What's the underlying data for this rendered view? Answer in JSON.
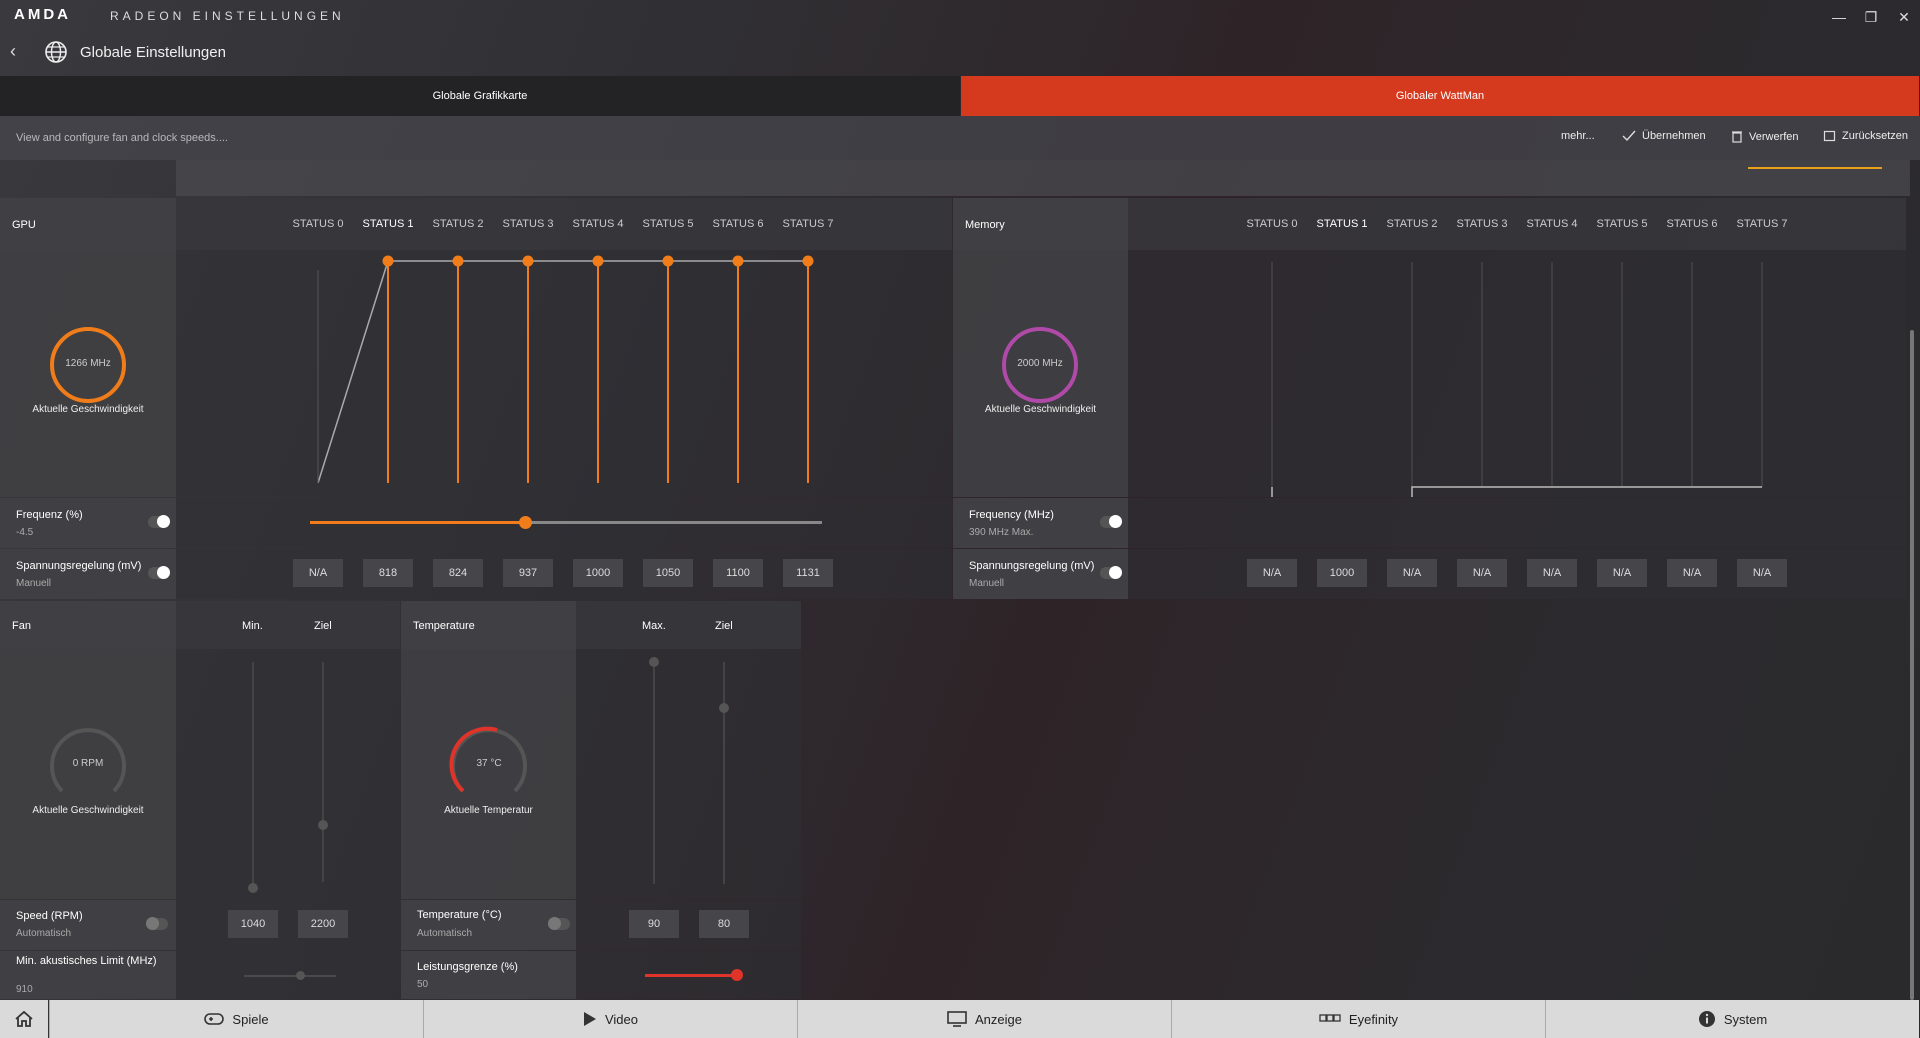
{
  "app": {
    "brand": "AMDA",
    "brand_sub": "RADEON EINSTELLUNGEN"
  },
  "header": {
    "title": "Globale Einstellungen"
  },
  "tabs": [
    {
      "label": "Globale Grafikkarte"
    },
    {
      "label": "Globaler WattMan"
    }
  ],
  "toolbar": {
    "description": "View and configure fan and clock speeds....",
    "more": "mehr...",
    "apply": "Übernehmen",
    "discard": "Verwerfen",
    "reset": "Zurücksetzen"
  },
  "gpu": {
    "label": "GPU",
    "speed": "1266 MHz",
    "speed_label": "Aktuelle Geschwindigkeit",
    "states": [
      "STATUS 0",
      "STATUS 1",
      "STATUS 2",
      "STATUS 3",
      "STATUS 4",
      "STATUS 5",
      "STATUS 6",
      "STATUS 7"
    ],
    "freq_label": "Frequenz (%)",
    "freq_value": "-4.5",
    "freq_slider": 0.42,
    "volt_label": "Spannungsregelung (mV)",
    "volt_mode": "Manuell",
    "volt_values": [
      "N/A",
      "818",
      "824",
      "937",
      "1000",
      "1050",
      "1100",
      "1131"
    ]
  },
  "memory": {
    "label": "Memory",
    "speed": "2000 MHz",
    "speed_label": "Aktuelle Geschwindigkeit",
    "states": [
      "STATUS 0",
      "STATUS 1",
      "STATUS 2",
      "STATUS 3",
      "STATUS 4",
      "STATUS 5",
      "STATUS 6",
      "STATUS 7"
    ],
    "freq_label": "Frequency (MHz)",
    "freq_value": "390 MHz Max.",
    "volt_label": "Spannungsregelung (mV)",
    "volt_mode": "Manuell",
    "volt_values": [
      "N/A",
      "1000",
      "N/A",
      "N/A",
      "N/A",
      "N/A",
      "N/A",
      "N/A"
    ]
  },
  "fan": {
    "label": "Fan",
    "col_min": "Min.",
    "col_target": "Ziel",
    "speed": "0 RPM",
    "speed_label": "Aktuelle Geschwindigkeit",
    "speed_row_label": "Speed (RPM)",
    "speed_row_mode": "Automatisch",
    "speed_min": "1040",
    "speed_target": "2200",
    "acoustic_label": "Min. akustisches Limit (MHz)",
    "acoustic_value": "910"
  },
  "temperature": {
    "label": "Temperature",
    "col_max": "Max.",
    "col_target": "Ziel",
    "current": "37 °C",
    "current_label": "Aktuelle Temperatur",
    "row_label": "Temperature (°C)",
    "row_mode": "Automatisch",
    "max": "90",
    "target": "80",
    "power_label": "Leistungsgrenze (%)",
    "power_value": "50",
    "power_slider": 1.0
  },
  "bottom_nav": [
    {
      "label": "Spiele",
      "icon": "gamepad-icon"
    },
    {
      "label": "Video",
      "icon": "play-icon"
    },
    {
      "label": "Anzeige",
      "icon": "monitor-icon"
    },
    {
      "label": "Eyefinity",
      "icon": "eyefinity-icon"
    },
    {
      "label": "System",
      "icon": "info-icon"
    }
  ],
  "colors": {
    "accent": "#d5391e",
    "gpu_ring": "#f07d1a",
    "memory_ring": "#b04aa8",
    "temp_ring": "#e0332a",
    "active_underline": "#e8a01a"
  }
}
